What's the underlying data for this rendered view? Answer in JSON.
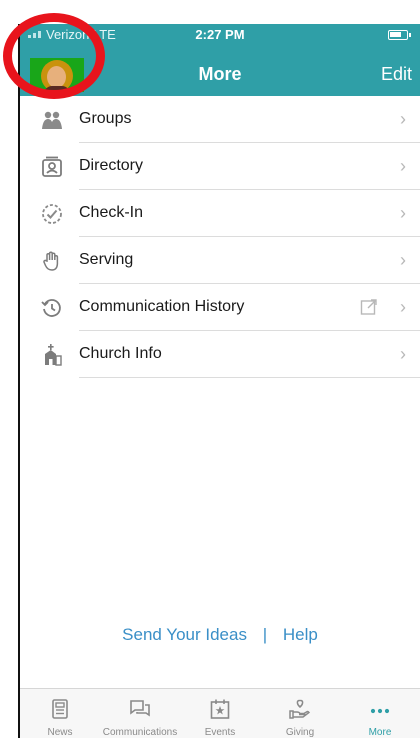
{
  "status_bar": {
    "carrier": "Verizon LTE",
    "time": "2:27 PM"
  },
  "header": {
    "title": "More",
    "edit_label": "Edit"
  },
  "menu": [
    {
      "label": "Groups",
      "icon": "groups-icon"
    },
    {
      "label": "Directory",
      "icon": "directory-icon"
    },
    {
      "label": "Check-In",
      "icon": "check-in-icon"
    },
    {
      "label": "Serving",
      "icon": "hand-icon"
    },
    {
      "label": "Communication History",
      "icon": "history-icon",
      "external": true
    },
    {
      "label": "Church Info",
      "icon": "church-icon"
    }
  ],
  "footer_links": {
    "ideas": "Send Your Ideas",
    "separator": "|",
    "help": "Help"
  },
  "tabs": [
    {
      "label": "News",
      "icon": "news-icon"
    },
    {
      "label": "Communications",
      "icon": "chat-icon"
    },
    {
      "label": "Events",
      "icon": "calendar-star-icon"
    },
    {
      "label": "Giving",
      "icon": "giving-hand-icon"
    },
    {
      "label": "More",
      "icon": "more-dots-icon",
      "active": true
    }
  ],
  "colors": {
    "accent": "#2f9fa7",
    "highlight_ring": "#e8141c",
    "link": "#3a8fc7"
  }
}
